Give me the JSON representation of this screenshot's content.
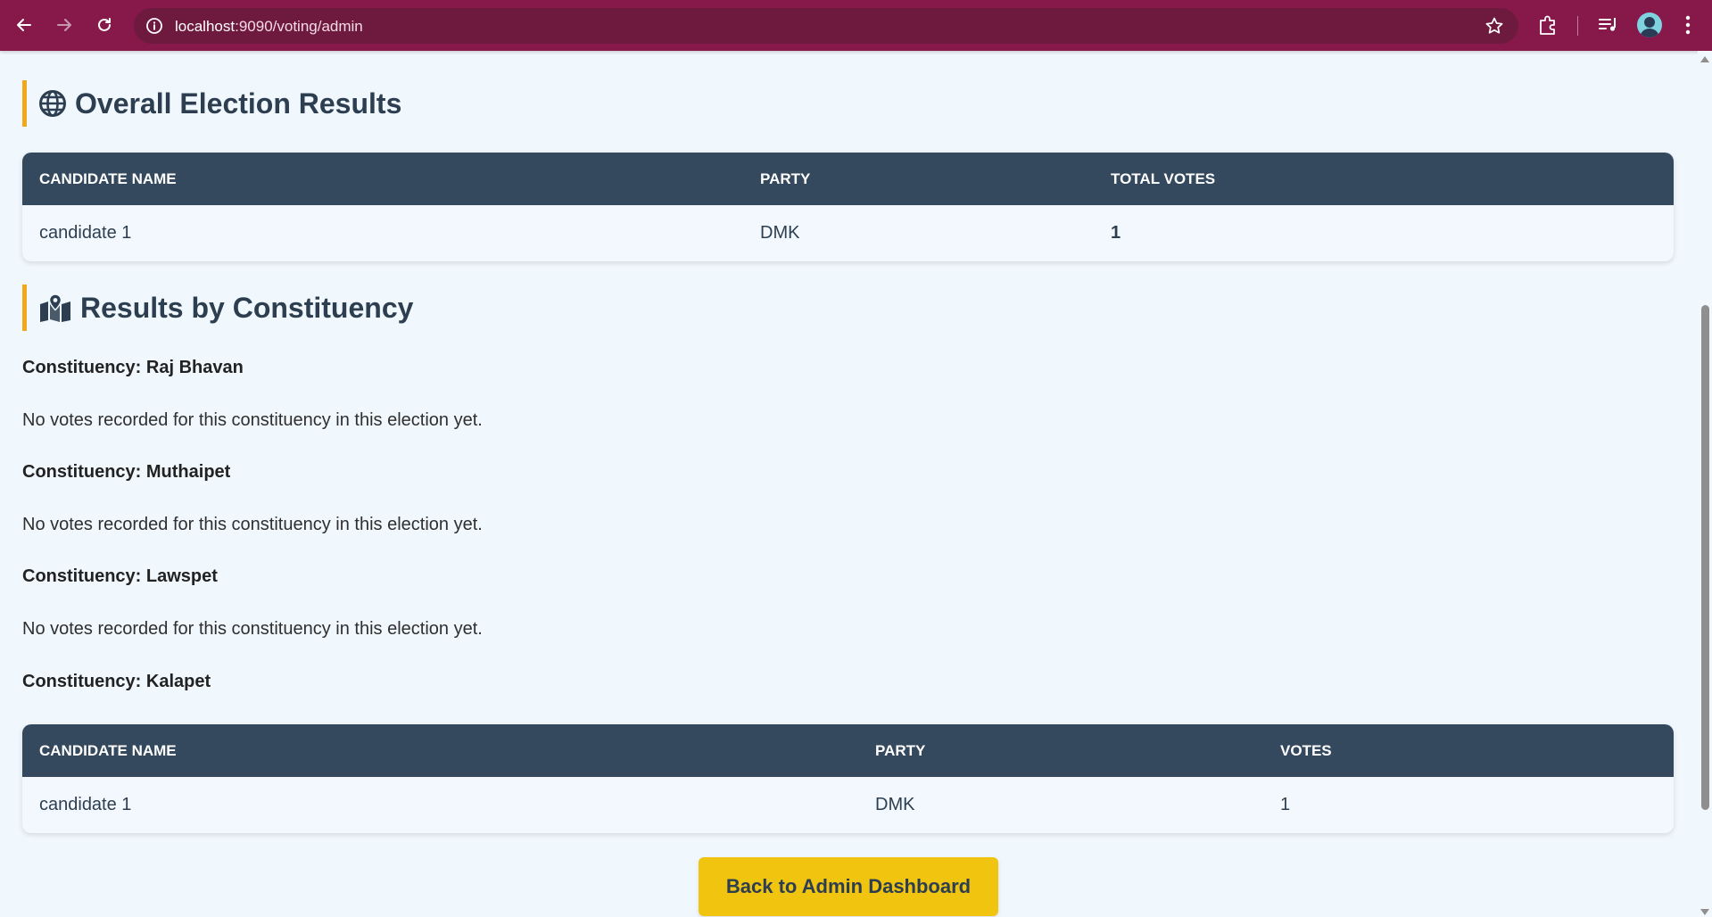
{
  "browser": {
    "url_host": "localhost",
    "url_rest": ":9090/voting/admin",
    "theme_color": "#86194a"
  },
  "overall": {
    "title": "Overall Election Results",
    "icon": "globe-icon",
    "columns": [
      "CANDIDATE NAME",
      "PARTY",
      "TOTAL VOTES"
    ],
    "rows": [
      {
        "name": "candidate 1",
        "party": "DMK",
        "votes": "1"
      }
    ]
  },
  "by_constituency": {
    "title": "Results by Constituency",
    "icon": "map-marked-icon",
    "items": [
      {
        "label": "Constituency: Raj Bhavan",
        "message": "No votes recorded for this constituency in this election yet."
      },
      {
        "label": "Constituency: Muthaipet",
        "message": "No votes recorded for this constituency in this election yet."
      },
      {
        "label": "Constituency: Lawspet",
        "message": "No votes recorded for this constituency in this election yet."
      },
      {
        "label": "Constituency: Kalapet",
        "message": ""
      }
    ],
    "kalapet_table": {
      "columns": [
        "CANDIDATE NAME",
        "PARTY",
        "VOTES"
      ],
      "rows": [
        {
          "name": "candidate 1",
          "party": "DMK",
          "votes": "1"
        }
      ]
    }
  },
  "actions": {
    "back_label": "Back to Admin Dashboard",
    "back_color": "#f1c40f"
  },
  "colors": {
    "accent_bar": "#f2a81d",
    "table_header": "#34495e",
    "heading_text": "#2c3e50"
  }
}
